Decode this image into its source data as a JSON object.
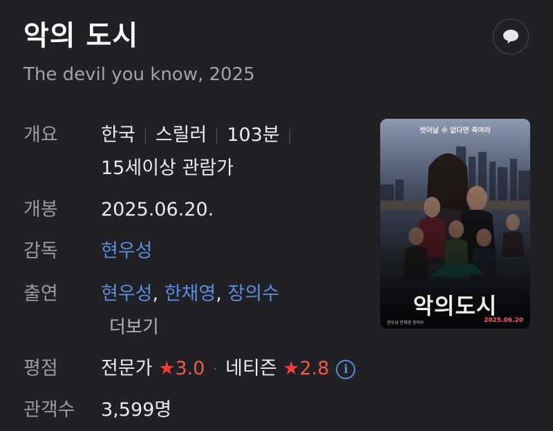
{
  "header": {
    "title": "악의 도시",
    "subtitle": "The devil you know, 2025",
    "talk_icon": "speech-bubble-icon"
  },
  "info": {
    "overview": {
      "label": "개요",
      "country": "한국",
      "genre": "스릴러",
      "runtime": "103분",
      "rating": "15세이상 관람가"
    },
    "release": {
      "label": "개봉",
      "value": "2025.06.20."
    },
    "director": {
      "label": "감독",
      "name": "현우성"
    },
    "cast": {
      "label": "출연",
      "names": [
        "현우성",
        "한채영",
        "장의수"
      ],
      "more": "더보기"
    },
    "score": {
      "label": "평점",
      "critic_label": "전문가",
      "critic_score": "3.0",
      "netizen_label": "네티즌",
      "netizen_score": "2.8",
      "star_color": "#ef3c3c",
      "info_icon": "info-circle-icon"
    },
    "audience": {
      "label": "관객수",
      "value": "3,599명"
    }
  },
  "poster": {
    "tagline": "벗어날 수 없다면 죽여라",
    "title": "악의도시",
    "credits": "현우성 한채영 장의수",
    "date": "2025.06.20"
  },
  "colors": {
    "background": "#202025",
    "link": "#5b8dde",
    "accent_red": "#ef3c3c"
  }
}
